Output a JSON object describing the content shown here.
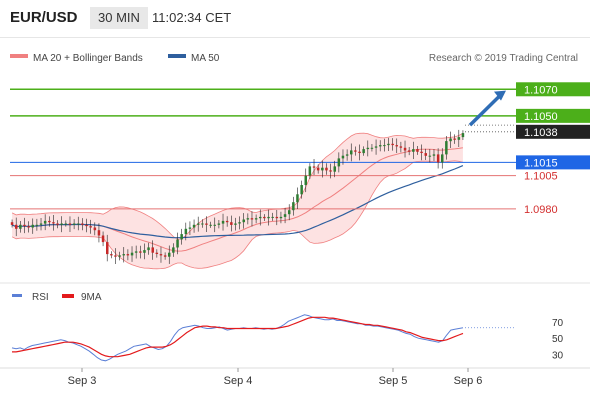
{
  "header": {
    "pair": "EUR/USD",
    "timeframe": "30 MIN",
    "time": "11:02:34 CET"
  },
  "legend": {
    "bollinger": "MA 20 + Bollinger Bands",
    "ma50": "MA 50",
    "credit": "Research © 2019 Trading Central"
  },
  "colors": {
    "candle_up": "#2e7d32",
    "candle_down": "#c62828",
    "bollinger": "#f08080",
    "band_fill": "#fde2e2",
    "ma50": "#2e5f9e",
    "target": "#4caf1a",
    "resistance": "#e57373",
    "support_ma": "#1f66e5",
    "current": "#222222",
    "arrow": "#2f6db5",
    "rsi": "#5b7fd6",
    "rsi_ma": "#e31a1c"
  },
  "chart_data": [
    {
      "type": "candlestick",
      "ylim": [
        1.0928,
        1.1083
      ],
      "x_labels": [
        "Sep 3",
        "Sep 4",
        "Sep 5",
        "Sep 6"
      ],
      "close": [
        1.0968,
        1.0965,
        1.0968,
        1.0967,
        1.0966,
        1.0968,
        1.0968,
        1.0969,
        1.0971,
        1.097,
        1.0969,
        1.0968,
        1.0969,
        1.0969,
        1.0968,
        1.0969,
        1.0969,
        1.0968,
        1.0967,
        1.0966,
        1.0964,
        1.096,
        1.0955,
        1.0946,
        1.0945,
        1.0944,
        1.0945,
        1.0946,
        1.0945,
        1.0947,
        1.0948,
        1.0947,
        1.0949,
        1.0951,
        1.0947,
        1.0946,
        1.0945,
        1.0944,
        1.0947,
        1.0951,
        1.0957,
        1.0961,
        1.0965,
        1.0966,
        1.0968,
        1.0969,
        1.0969,
        1.0968,
        1.0968,
        1.0968,
        1.0969,
        1.0971,
        1.097,
        1.0968,
        1.0969,
        1.097,
        1.0972,
        1.0973,
        1.0972,
        1.0973,
        1.0974,
        1.0973,
        1.0974,
        1.0974,
        1.0973,
        1.0974,
        1.0976,
        1.0979,
        1.0985,
        1.0991,
        1.0998,
        1.1005,
        1.1012,
        1.1011,
        1.1009,
        1.1011,
        1.1009,
        1.1008,
        1.1012,
        1.1018,
        1.102,
        1.1021,
        1.1024,
        1.1023,
        1.1022,
        1.1025,
        1.1026,
        1.1026,
        1.1027,
        1.1028,
        1.1028,
        1.1029,
        1.1028,
        1.1027,
        1.1026,
        1.1024,
        1.1023,
        1.1025,
        1.1023,
        1.1022,
        1.102,
        1.102,
        1.1021,
        1.1015,
        1.1021,
        1.1031,
        1.1033,
        1.1032,
        1.1034,
        1.1037
      ],
      "annotated_levels": [
        {
          "label": "1.1070",
          "value": 1.107,
          "style": "target"
        },
        {
          "label": "1.1050",
          "value": 1.105,
          "style": "target"
        },
        {
          "label": "1.1038",
          "value": 1.1038,
          "style": "current"
        },
        {
          "label": "1.1015",
          "value": 1.1015,
          "style": "support_ma"
        },
        {
          "label": "1.1005",
          "value": 1.1005,
          "style": "resistance"
        },
        {
          "label": "1.0980",
          "value": 1.098,
          "style": "resistance"
        }
      ]
    },
    {
      "type": "line",
      "series": [
        {
          "name": "RSI"
        },
        {
          "name": "9MA"
        }
      ],
      "ylim": [
        18,
        85
      ],
      "yticks": [
        "70",
        "50",
        "30"
      ],
      "ytick_values": [
        70,
        50,
        30
      ],
      "dotted_level": 63,
      "rsi": [
        38,
        37,
        38,
        36,
        39,
        41,
        42,
        43,
        44,
        45,
        46,
        47,
        48,
        47,
        45,
        44,
        42,
        40,
        37,
        34,
        30,
        26,
        23,
        22,
        24,
        27,
        30,
        32,
        34,
        37,
        40,
        41,
        42,
        43,
        40,
        38,
        36,
        37,
        40,
        46,
        54,
        60,
        63,
        64,
        65,
        66,
        65,
        63,
        62,
        62,
        63,
        64,
        62,
        60,
        61,
        62,
        62,
        63,
        62,
        62,
        63,
        62,
        61,
        62,
        61,
        62,
        64,
        67,
        71,
        73,
        75,
        77,
        79,
        78,
        76,
        75,
        74,
        73,
        73,
        74,
        72,
        72,
        71,
        70,
        69,
        68,
        68,
        66,
        66,
        65,
        65,
        64,
        63,
        62,
        61,
        60,
        58,
        56,
        55,
        52,
        50,
        49,
        48,
        47,
        46,
        45,
        47,
        54,
        60,
        61,
        62,
        63
      ],
      "ma": [
        33,
        33,
        34,
        35,
        36,
        37,
        38,
        39,
        40,
        41,
        42,
        43,
        44,
        45,
        45,
        45,
        44,
        43,
        41,
        39,
        36,
        33,
        30,
        28,
        27,
        27,
        27,
        28,
        29,
        30,
        32,
        34,
        36,
        38,
        39,
        39,
        39,
        39,
        40,
        42,
        45,
        49,
        53,
        57,
        60,
        63,
        64,
        65,
        65,
        64,
        64,
        63,
        63,
        62,
        62,
        62,
        62,
        62,
        62,
        62,
        62,
        62,
        62,
        62,
        62,
        62,
        63,
        64,
        65,
        67,
        69,
        71,
        73,
        75,
        76,
        76,
        76,
        76,
        75,
        75,
        74,
        73,
        72,
        71,
        70,
        69,
        68,
        67,
        67,
        66,
        66,
        65,
        64,
        63,
        62,
        61,
        60,
        58,
        57,
        55,
        53,
        51,
        50,
        49,
        48,
        47,
        47,
        48,
        50,
        52,
        54,
        56
      ]
    }
  ]
}
